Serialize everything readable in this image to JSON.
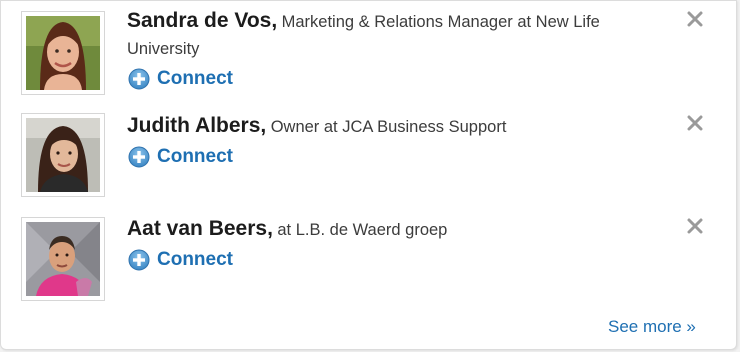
{
  "people": [
    {
      "name": "Sandra de Vos",
      "separator": ",",
      "title": "Marketing & Relations Manager at New Life University",
      "connect_label": "Connect",
      "connect_icon": "plus-circle-icon",
      "dismiss_icon": "close-icon"
    },
    {
      "name": "Judith Albers",
      "separator": ",",
      "title": "Owner at JCA Business Support",
      "connect_label": "Connect",
      "connect_icon": "plus-circle-icon",
      "dismiss_icon": "close-icon"
    },
    {
      "name": "Aat van Beers",
      "separator": ",",
      "title": "at L.B. de Waerd groep",
      "connect_label": "Connect",
      "connect_icon": "plus-circle-icon",
      "dismiss_icon": "close-icon"
    }
  ],
  "see_more": "See more »",
  "colors": {
    "link": "#1e6fb2",
    "name": "#1c1c1c",
    "close": "#9a9a9a"
  }
}
